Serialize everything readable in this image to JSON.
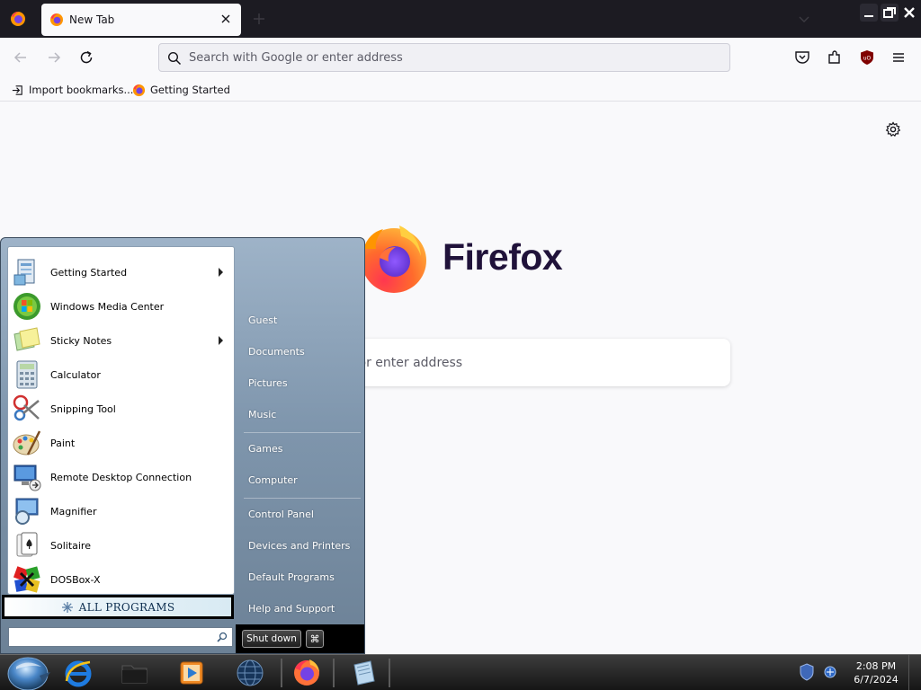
{
  "browser": {
    "tab_title": "New Tab",
    "url_placeholder": "Search with Google or enter address",
    "bookmarks": [
      {
        "label": "Import bookmarks..."
      },
      {
        "label": "Getting Started"
      }
    ]
  },
  "newtab": {
    "brand": "Firefox",
    "search_placeholder": "Search with Google or enter address",
    "visible_search_text": "r enter address"
  },
  "start_menu": {
    "programs": [
      {
        "label": "Getting Started",
        "submenu": true,
        "icon": "getting-started-icon"
      },
      {
        "label": "Windows Media Center",
        "submenu": false,
        "icon": "media-center-icon"
      },
      {
        "label": "Sticky Notes",
        "submenu": true,
        "icon": "sticky-notes-icon"
      },
      {
        "label": "Calculator",
        "submenu": false,
        "icon": "calculator-icon"
      },
      {
        "label": "Snipping Tool",
        "submenu": false,
        "icon": "snipping-tool-icon"
      },
      {
        "label": "Paint",
        "submenu": false,
        "icon": "paint-icon"
      },
      {
        "label": "Remote Desktop Connection",
        "submenu": false,
        "icon": "remote-desktop-icon"
      },
      {
        "label": "Magnifier",
        "submenu": false,
        "icon": "magnifier-icon"
      },
      {
        "label": "Solitaire",
        "submenu": false,
        "icon": "solitaire-icon"
      },
      {
        "label": "DOSBox-X",
        "submenu": false,
        "icon": "dosbox-icon"
      }
    ],
    "all_programs": "ALL PROGRAMS",
    "right_links": [
      "Guest",
      "Documents",
      "Pictures",
      "Music",
      "Games",
      "Computer",
      "Control Panel",
      "Devices and Printers",
      "Default Programs",
      "Help and Support"
    ],
    "shutdown_label": "Shut down",
    "shutdown_options_glyph": "⌘"
  },
  "taskbar": {
    "time": "2:08 PM",
    "date": "6/7/2024"
  },
  "colors": {
    "firefox_orange": "#ff9500",
    "firefox_purple": "#7542e5",
    "ublock_red": "#800000",
    "start_menu_blue": "#7f96ad"
  }
}
